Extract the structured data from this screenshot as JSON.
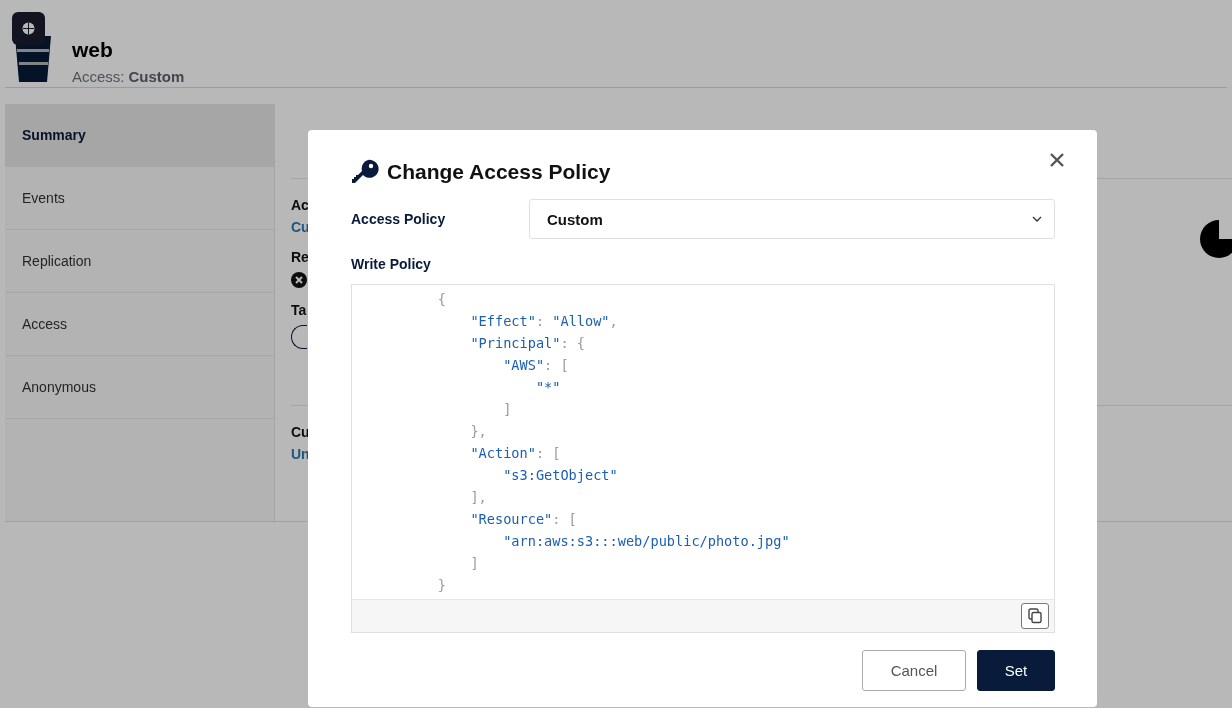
{
  "bucket": {
    "name": "web",
    "access_label": "Access:",
    "access_value": "Custom"
  },
  "sidebar": {
    "items": [
      {
        "label": "Summary",
        "selected": true
      },
      {
        "label": "Events",
        "selected": false
      },
      {
        "label": "Replication",
        "selected": false
      },
      {
        "label": "Access",
        "selected": false
      },
      {
        "label": "Anonymous",
        "selected": false
      }
    ]
  },
  "content_fragments": {
    "access_label": "Ac",
    "access_value": "Cu",
    "replication_label": "Re",
    "tags_label": "Ta",
    "current_label": "Cu",
    "current_value": "Un"
  },
  "dialog": {
    "title": "Change Access Policy",
    "access_policy_label": "Access Policy",
    "access_policy_value": "Custom",
    "write_policy_label": "Write Policy",
    "code_lines": [
      "         {",
      "             \"Effect\": \"Allow\",",
      "             \"Principal\": {",
      "                 \"AWS\": [",
      "                     \"*\"",
      "                 ]",
      "             },",
      "             \"Action\": [",
      "                 \"s3:GetObject\"",
      "             ],",
      "             \"Resource\": [",
      "                 \"arn:aws:s3:::web/public/photo.jpg\"",
      "             ]",
      "         }"
    ],
    "buttons": [
      {
        "label": "Cancel",
        "kind": "secondary"
      },
      {
        "label": "Set",
        "kind": "primary"
      }
    ]
  }
}
